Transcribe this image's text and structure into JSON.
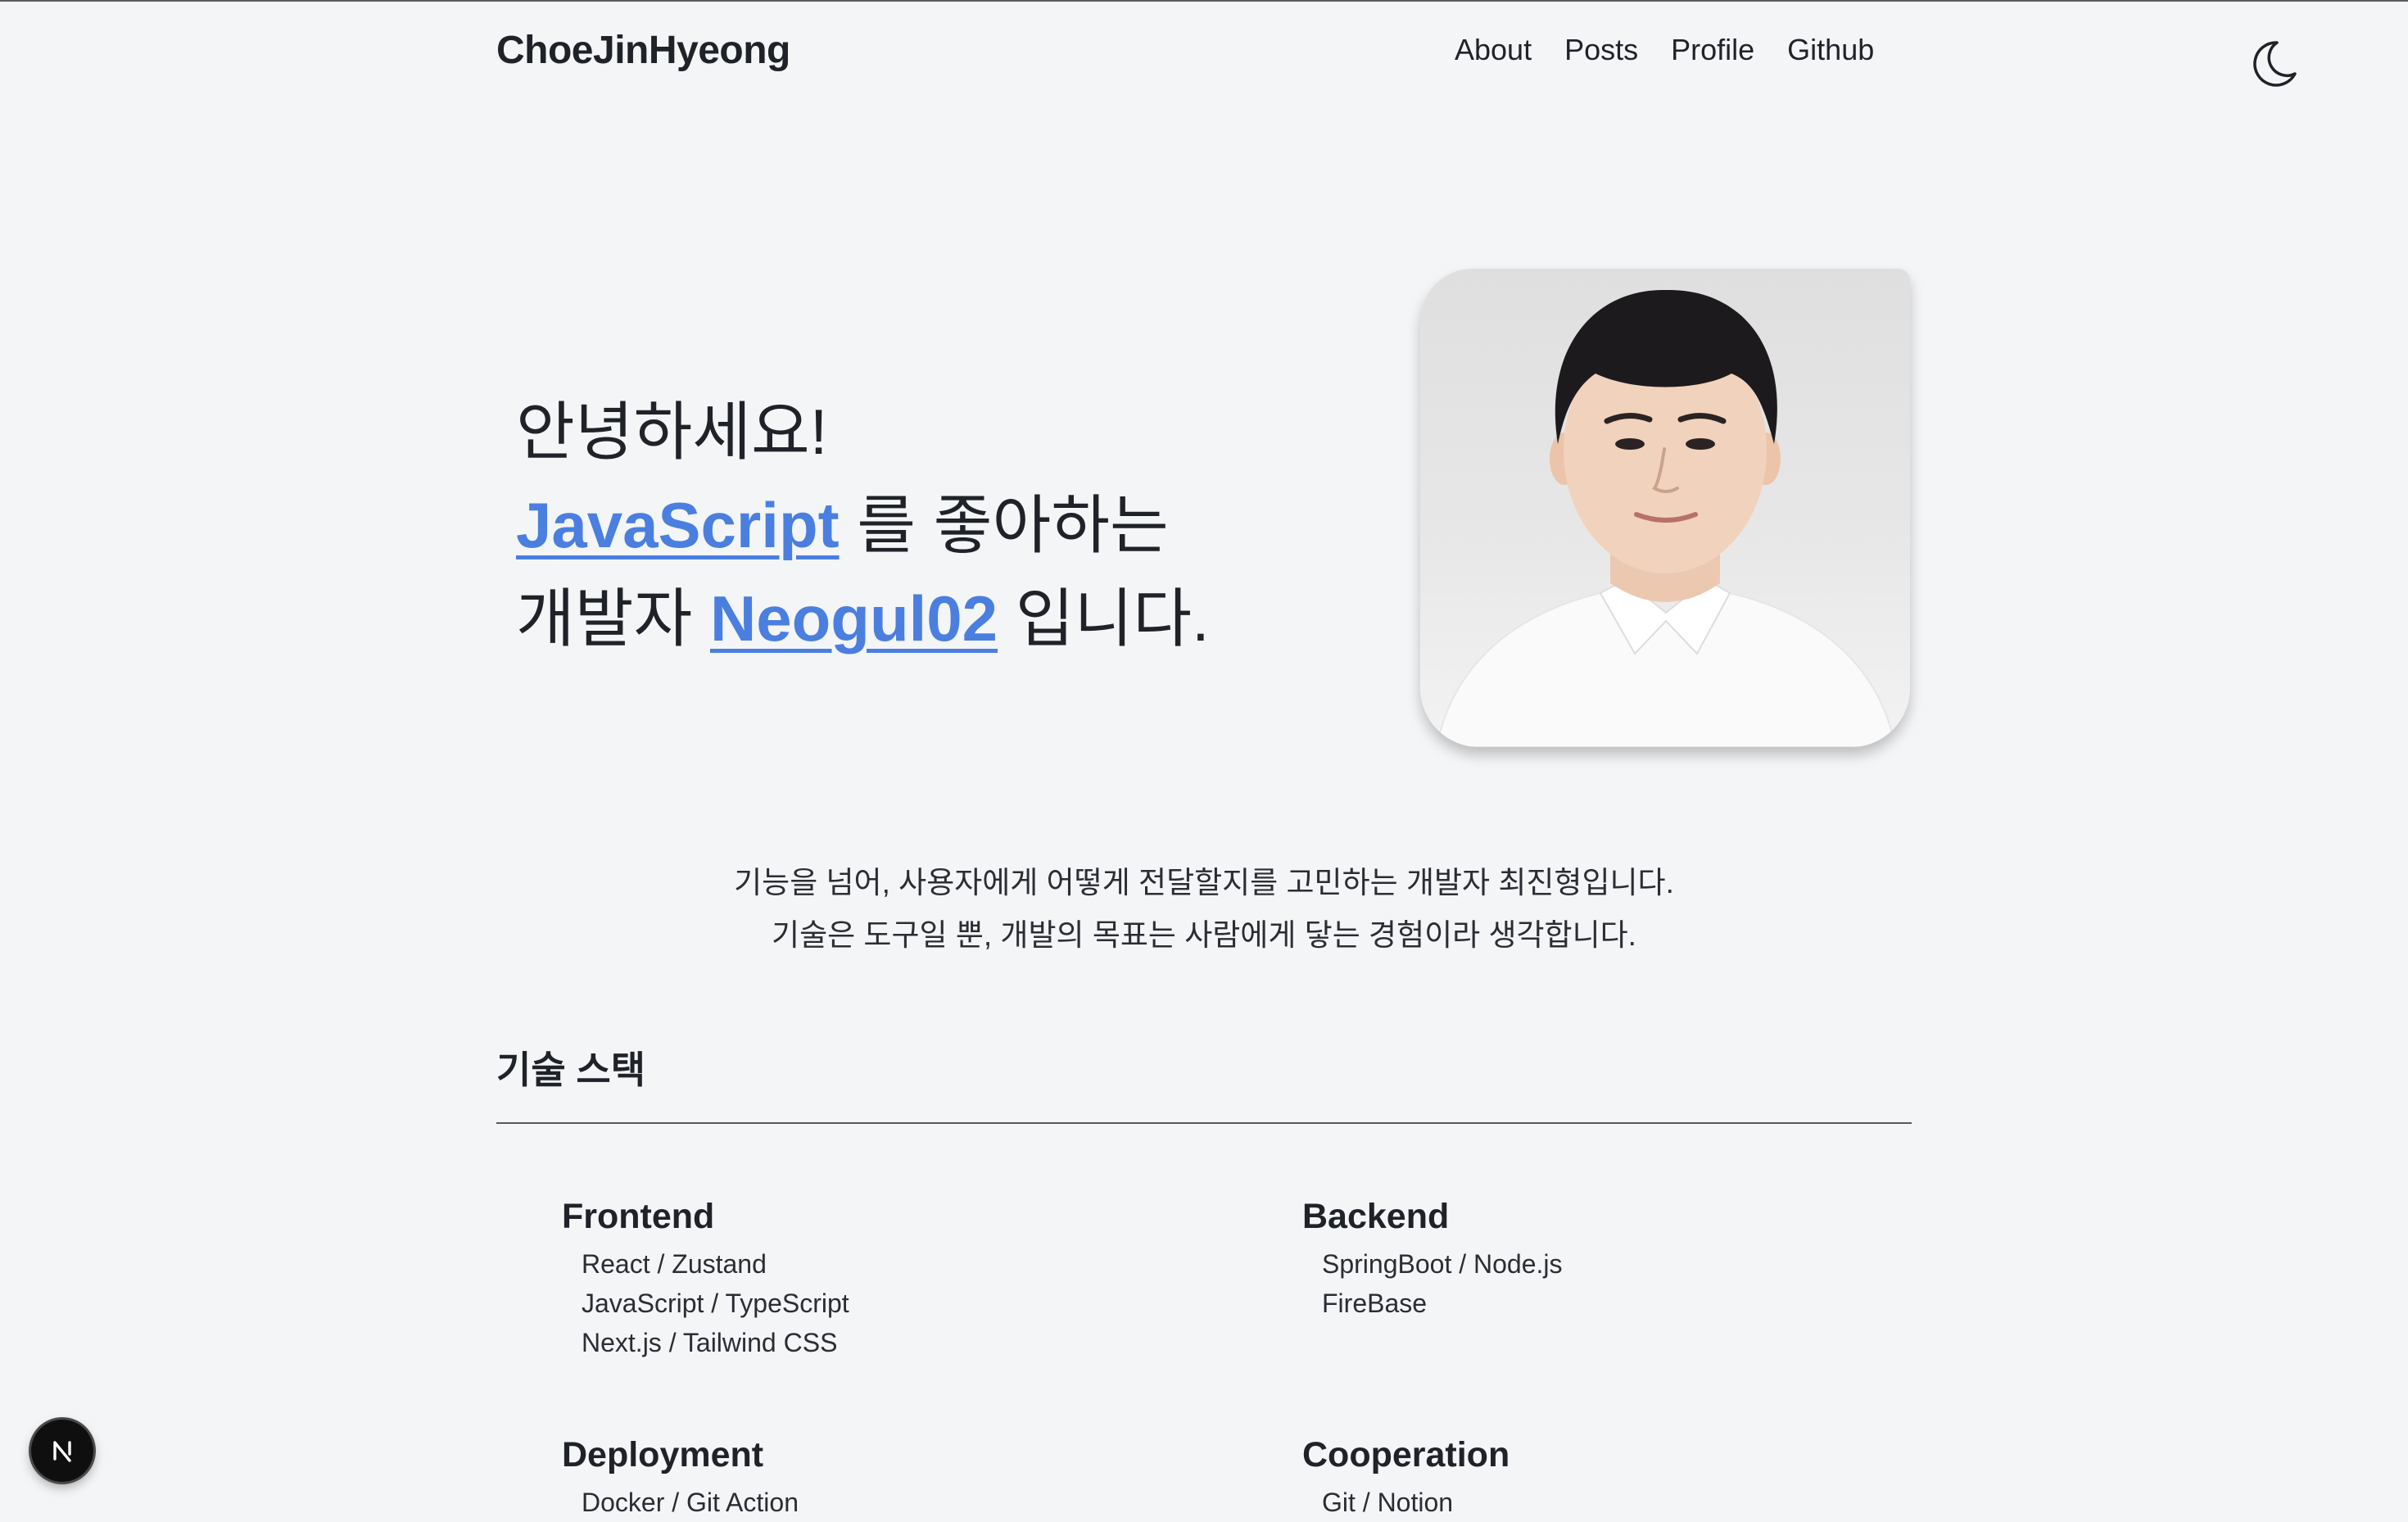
{
  "header": {
    "title": "ChoeJinHyeong",
    "nav": [
      {
        "label": "About"
      },
      {
        "label": "Posts"
      },
      {
        "label": "Profile"
      },
      {
        "label": "Github"
      }
    ],
    "theme_toggle_icon": "moon-icon"
  },
  "hero": {
    "greeting": "안녕하세요!",
    "tech_link": "JavaScript",
    "line2_suffix": " 를 좋아하는",
    "line3_prefix": "개발자 ",
    "name_link": "Neogul02",
    "line3_suffix": " 입니다.",
    "link_color": "#4a7fe0"
  },
  "intro": {
    "line1": "기능을 넘어, 사용자에게 어떻게 전달할지를 고민하는 개발자 최진형입니다.",
    "line2": "기술은 도구일 뿐, 개발의 목표는 사람에게 닿는 경험이라 생각합니다."
  },
  "stack": {
    "title": "기술 스택",
    "groups": [
      {
        "name": "Frontend",
        "items": [
          "React / Zustand",
          "JavaScript / TypeScript",
          "Next.js / Tailwind CSS"
        ]
      },
      {
        "name": "Backend",
        "items": [
          "SpringBoot / Node.js",
          "FireBase"
        ]
      },
      {
        "name": "Deployment",
        "items": [
          "Docker / Git Action"
        ]
      },
      {
        "name": "Cooperation",
        "items": [
          "Git / Notion"
        ]
      }
    ]
  },
  "dev_badge": {
    "letter": "N"
  }
}
